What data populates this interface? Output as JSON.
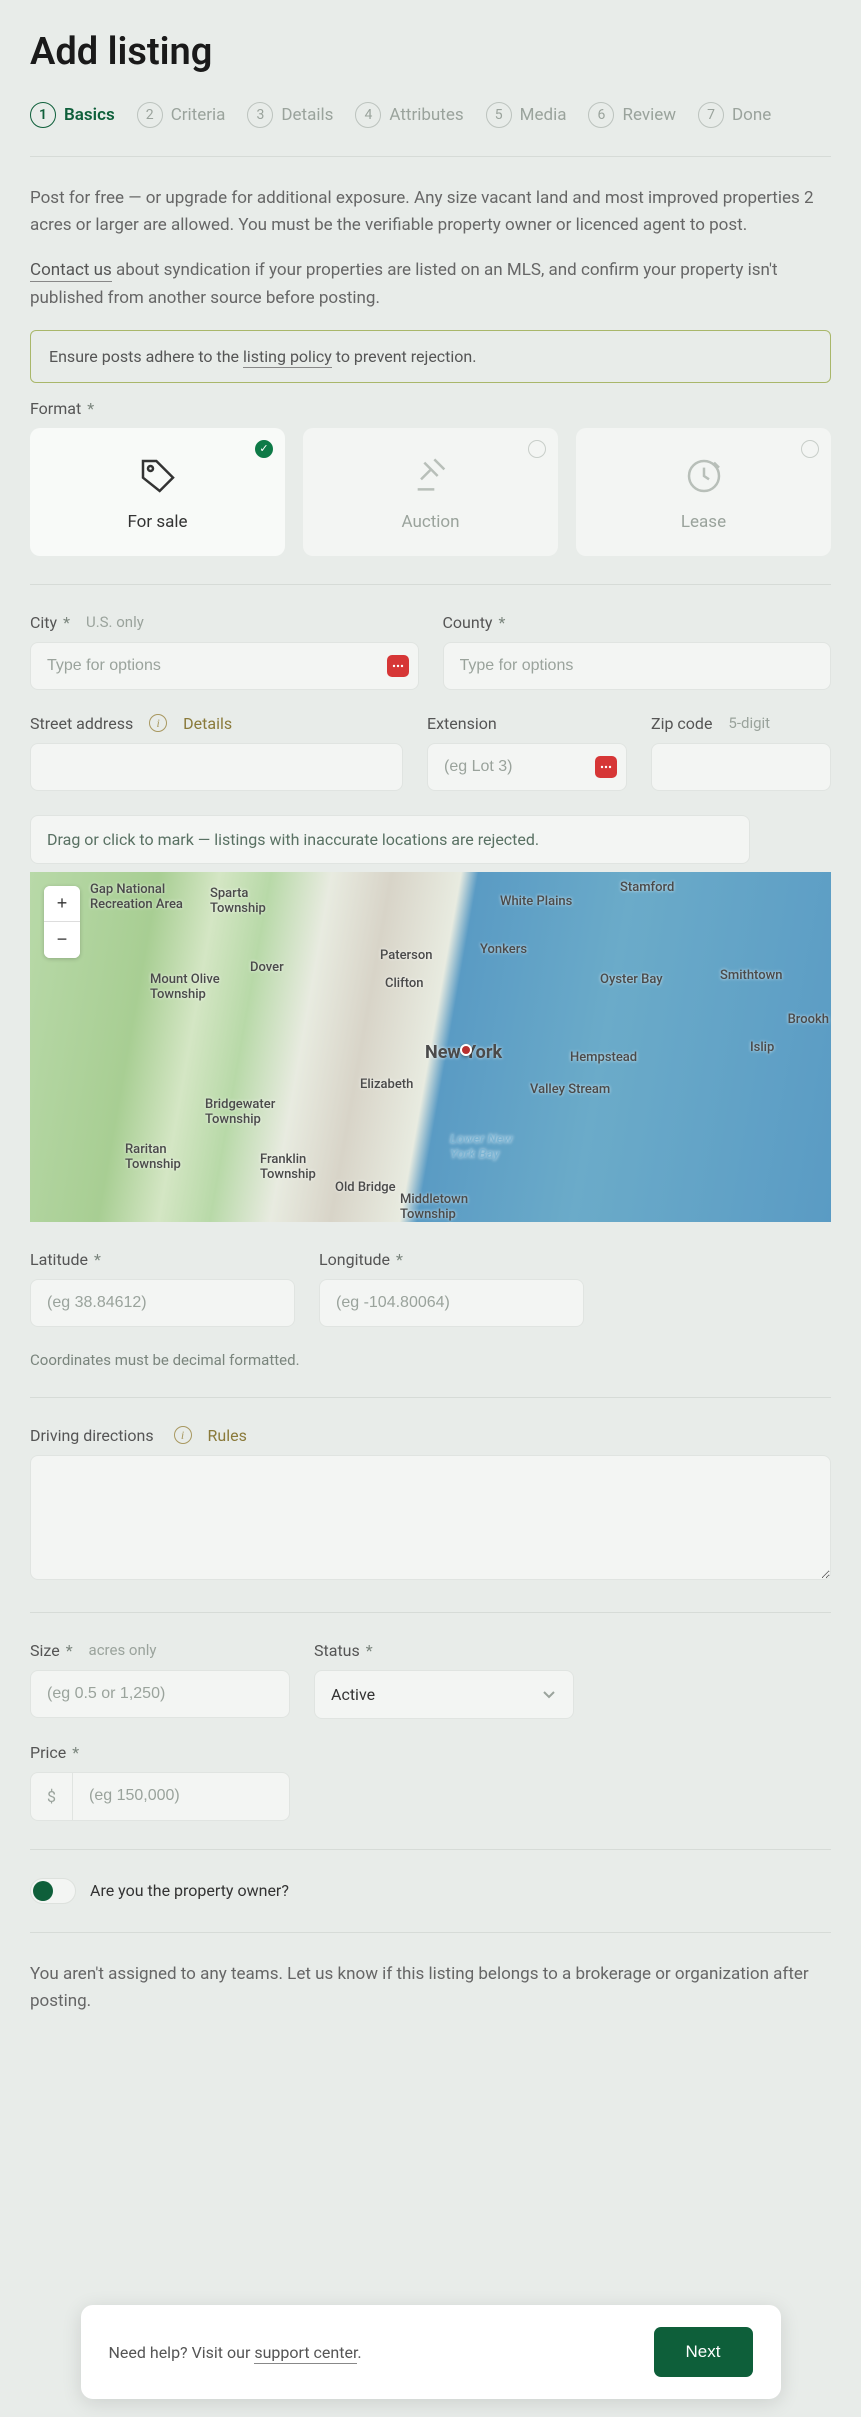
{
  "title": "Add listing",
  "steps": [
    {
      "num": "1",
      "label": "Basics",
      "active": true
    },
    {
      "num": "2",
      "label": "Criteria"
    },
    {
      "num": "3",
      "label": "Details"
    },
    {
      "num": "4",
      "label": "Attributes"
    },
    {
      "num": "5",
      "label": "Media"
    },
    {
      "num": "6",
      "label": "Review"
    },
    {
      "num": "7",
      "label": "Done"
    }
  ],
  "intro1": "Post for free — or upgrade for additional exposure. Any size vacant land and most improved properties 2 acres or larger are allowed. You must be the verifiable property owner or licenced agent to post.",
  "contact_link": "Contact us",
  "intro2": " about syndication if your properties are listed on an MLS, and confirm your property isn't published from another source before posting.",
  "policy_pre": "Ensure posts adhere to the ",
  "policy_link": "listing policy",
  "policy_post": " to prevent rejection.",
  "format": {
    "label": "Format",
    "options": [
      {
        "label": "For sale",
        "selected": true
      },
      {
        "label": "Auction"
      },
      {
        "label": "Lease"
      }
    ]
  },
  "city": {
    "label": "City",
    "hint": "U.S. only",
    "placeholder": "Type for options"
  },
  "county": {
    "label": "County",
    "placeholder": "Type for options"
  },
  "street": {
    "label": "Street address",
    "details": "Details"
  },
  "extension": {
    "label": "Extension",
    "placeholder": "(eg Lot 3)"
  },
  "zip": {
    "label": "Zip code",
    "hint": "5-digit"
  },
  "map_hint": "Drag or click to mark — listings with inaccurate locations are rejected.",
  "map_labels": {
    "gap": "Gap National\nRecreation Area",
    "sparta": "Sparta\nTownship",
    "whiteplains": "White Plains",
    "stamford": "Stamford",
    "dover": "Dover",
    "paterson": "Paterson",
    "yonkers": "Yonkers",
    "clifton": "Clifton",
    "molive": "Mount Olive\nTownship",
    "oysterbay": "Oyster Bay",
    "smithtown": "Smithtown",
    "newyork": "New York",
    "hempstead": "Hempstead",
    "islip": "Islip",
    "brookh": "Brookh",
    "elizabeth": "Elizabeth",
    "valleystream": "Valley Stream",
    "bridgewater": "Bridgewater\nTownship",
    "raritan": "Raritan\nTownship",
    "franklin": "Franklin\nTownship",
    "oldbridge": "Old Bridge",
    "middletown": "Middletown\nTownship",
    "lowerbay": "Lower New\nYork Bay"
  },
  "latitude": {
    "label": "Latitude",
    "placeholder": "(eg 38.84612)"
  },
  "longitude": {
    "label": "Longitude",
    "placeholder": "(eg -104.80064)"
  },
  "coord_note": "Coordinates must be decimal formatted.",
  "driving": {
    "label": "Driving directions",
    "rules": "Rules"
  },
  "size": {
    "label": "Size",
    "hint": "acres only",
    "placeholder": "(eg 0.5 or 1,250)"
  },
  "status": {
    "label": "Status",
    "value": "Active"
  },
  "price": {
    "label": "Price",
    "prefix": "$",
    "placeholder": "(eg 150,000)"
  },
  "owner_q": "Are you the property owner?",
  "teams_note": "You aren't assigned to any teams. Let us know if this listing belongs to a brokerage or organization after posting.",
  "footer": {
    "help_pre": "Need help? Visit our ",
    "help_link": "support center",
    "next": "Next"
  }
}
